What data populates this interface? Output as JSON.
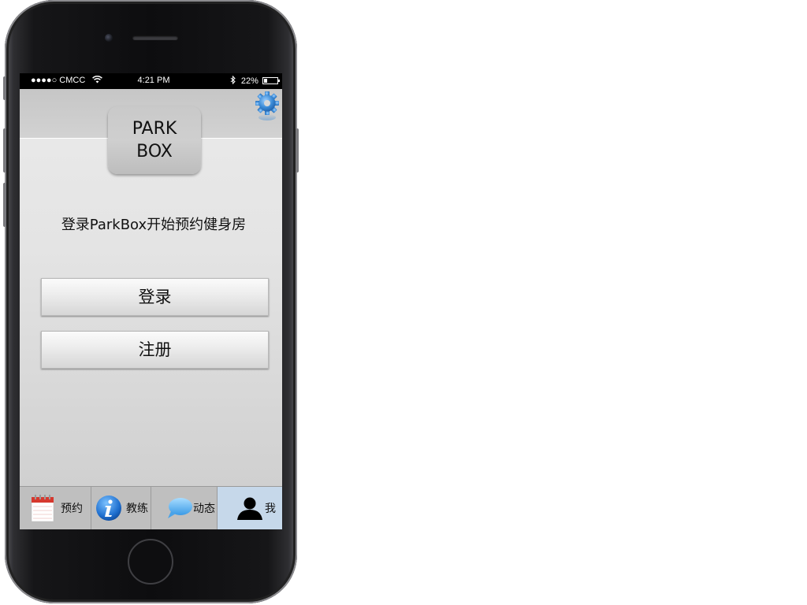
{
  "status_bar": {
    "carrier": "●●●●○ CMCC",
    "time": "4:21 PM",
    "battery": "22%"
  },
  "logo": {
    "line1": "PARK",
    "line2": "BOX"
  },
  "tagline": "登录ParkBox开始预约健身房",
  "buttons": {
    "login": "登录",
    "register": "注册"
  },
  "tabs": [
    {
      "label": "预约",
      "icon": "calendar-icon",
      "selected": false
    },
    {
      "label": "教练",
      "icon": "info-icon",
      "selected": false
    },
    {
      "label": "动态",
      "icon": "speech-bubble-icon",
      "selected": false
    },
    {
      "label": "我",
      "icon": "person-icon",
      "selected": true
    }
  ],
  "colors": {
    "selected_tab": "#c6d8ea",
    "gear_blue": "#3a8ad6"
  }
}
